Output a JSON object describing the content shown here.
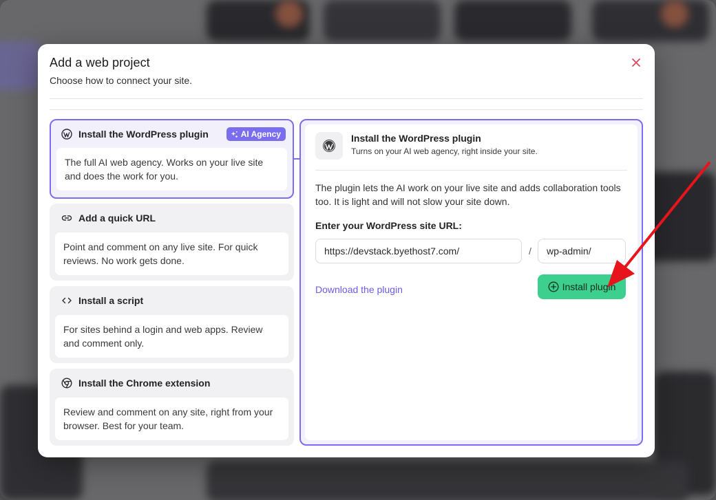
{
  "dialog": {
    "title": "Add a web project",
    "subtitle": "Choose how to connect your site."
  },
  "options": [
    {
      "title": "Install the WordPress plugin",
      "badge": "AI Agency",
      "description": "The full AI web agency. Works on your live site and does the work for you.",
      "icon": "wordpress-icon",
      "selected": true
    },
    {
      "title": "Add a quick URL",
      "description": "Point and comment on any live site. For quick reviews. No work gets done.",
      "icon": "link-icon"
    },
    {
      "title": "Install a script",
      "description": "For sites behind a login and web apps. Review and comment only.",
      "icon": "code-icon"
    },
    {
      "title": "Install the Chrome extension",
      "description": "Review and comment on any site, right from your browser. Best for your team.",
      "icon": "chrome-icon"
    }
  ],
  "panel": {
    "title": "Install the WordPress plugin",
    "subtitle": "Turns on your AI web agency, right inside your site.",
    "description": "The plugin lets the AI work on your live site and adds collaboration tools too. It is light and will not slow your site down.",
    "url_label": "Enter your WordPress site URL:",
    "url_value": "https://devstack.byethost7.com/",
    "separator": "/",
    "admin_path": "wp-admin/",
    "download_link": "Download the plugin",
    "install_button": "Install plugin"
  },
  "colors": {
    "accent": "#7b6df0",
    "install_button": "#3ccf8e",
    "close_icon": "#e0455a",
    "arrow": "#e8141c"
  }
}
